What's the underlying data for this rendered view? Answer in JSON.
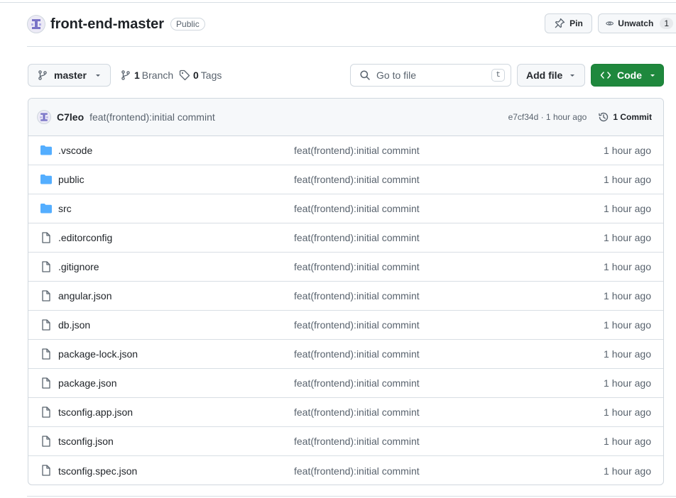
{
  "repo": {
    "name": "front-end-master",
    "visibility": "Public",
    "avatar_icon": "identicon"
  },
  "actions": {
    "pin_label": "Pin",
    "watch_label": "Unwatch",
    "watch_count": "1"
  },
  "toolbar": {
    "branch": "master",
    "branches_count": "1",
    "branches_label": "Branch",
    "tags_count": "0",
    "tags_label": "Tags",
    "search_placeholder": "Go to file",
    "search_shortcut": "t",
    "add_file_label": "Add file",
    "code_label": "Code"
  },
  "latest_commit": {
    "author": "C7leo",
    "message": "feat(frontend):initial commint",
    "hash_time": "e7cf34d · 1 hour ago",
    "commits_label": "1 Commit"
  },
  "files": [
    {
      "name": ".vscode",
      "type": "folder",
      "message": "feat(frontend):initial commint",
      "time": "1 hour ago"
    },
    {
      "name": "public",
      "type": "folder",
      "message": "feat(frontend):initial commint",
      "time": "1 hour ago"
    },
    {
      "name": "src",
      "type": "folder",
      "message": "feat(frontend):initial commint",
      "time": "1 hour ago"
    },
    {
      "name": ".editorconfig",
      "type": "file",
      "message": "feat(frontend):initial commint",
      "time": "1 hour ago"
    },
    {
      "name": ".gitignore",
      "type": "file",
      "message": "feat(frontend):initial commint",
      "time": "1 hour ago"
    },
    {
      "name": "angular.json",
      "type": "file",
      "message": "feat(frontend):initial commint",
      "time": "1 hour ago"
    },
    {
      "name": "db.json",
      "type": "file",
      "message": "feat(frontend):initial commint",
      "time": "1 hour ago"
    },
    {
      "name": "package-lock.json",
      "type": "file",
      "message": "feat(frontend):initial commint",
      "time": "1 hour ago"
    },
    {
      "name": "package.json",
      "type": "file",
      "message": "feat(frontend):initial commint",
      "time": "1 hour ago"
    },
    {
      "name": "tsconfig.app.json",
      "type": "file",
      "message": "feat(frontend):initial commint",
      "time": "1 hour ago"
    },
    {
      "name": "tsconfig.json",
      "type": "file",
      "message": "feat(frontend):initial commint",
      "time": "1 hour ago"
    },
    {
      "name": "tsconfig.spec.json",
      "type": "file",
      "message": "feat(frontend):initial commint",
      "time": "1 hour ago"
    }
  ],
  "colors": {
    "folder": "#54aeff",
    "file_icon": "#59636e",
    "code_button": "#1f883d",
    "border": "#d0d7de"
  }
}
